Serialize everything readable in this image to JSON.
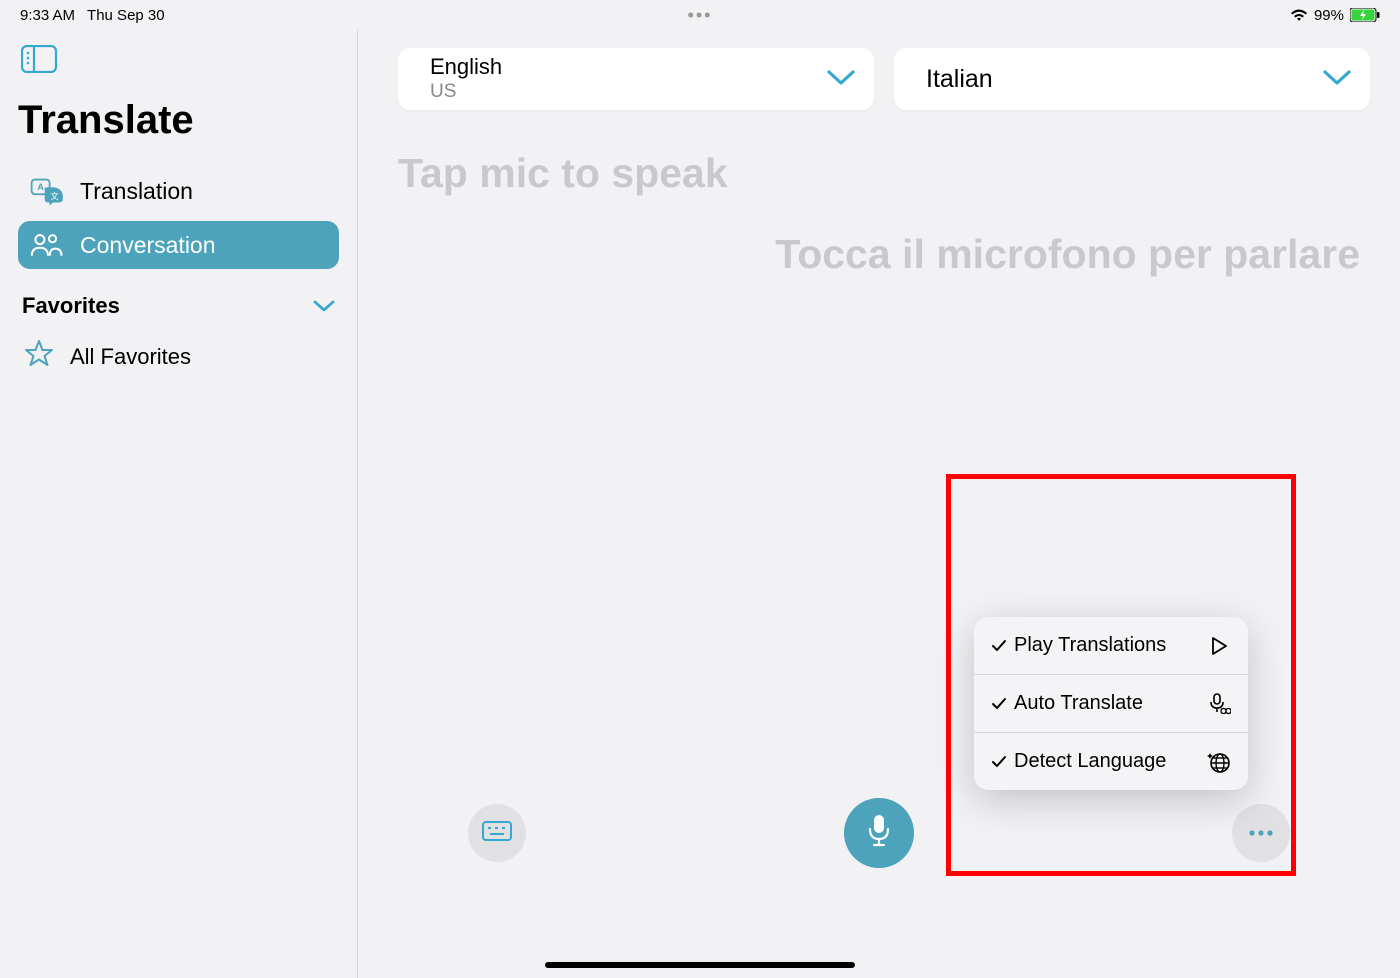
{
  "status": {
    "time": "9:33 AM",
    "date": "Thu Sep 30",
    "battery_pct": "99%"
  },
  "sidebar": {
    "title": "Translate",
    "items": [
      {
        "label": "Translation"
      },
      {
        "label": "Conversation"
      }
    ],
    "favorites_header": "Favorites",
    "all_favorites": "All Favorites"
  },
  "main": {
    "from_lang": "English",
    "from_sub": "US",
    "to_lang": "Italian",
    "hint_source": "Tap mic to speak",
    "hint_target": "Tocca il microfono per parlare"
  },
  "popup": {
    "item1": "Play Transla­tions",
    "item2": "Auto Translate",
    "item3": "Detect Language"
  }
}
